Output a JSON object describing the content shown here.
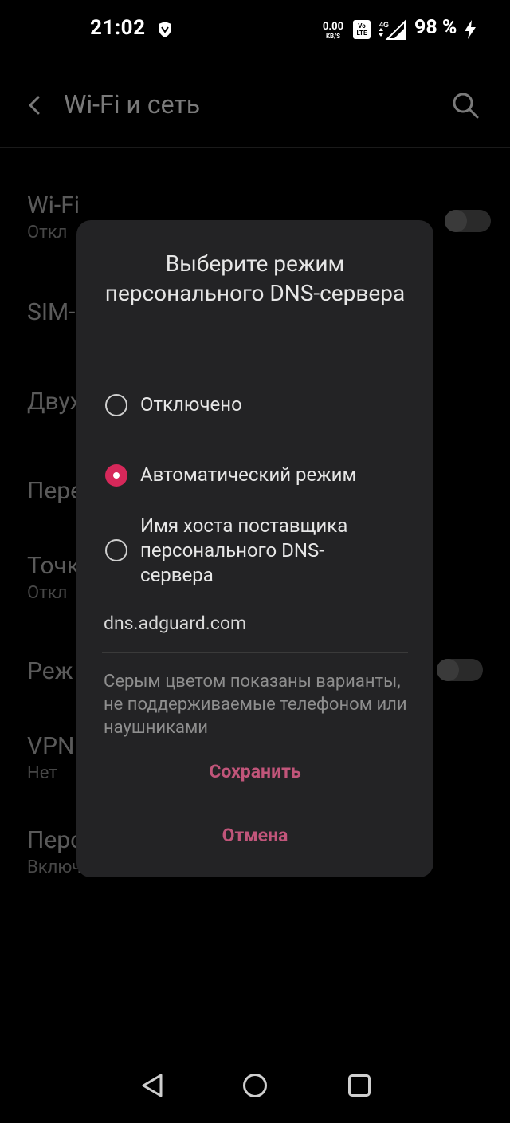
{
  "status_bar": {
    "time": "21:02",
    "net_speed_value": "0.00",
    "net_speed_unit": "KB/S",
    "volte_top": "Vo",
    "volte_bottom": "LTE",
    "network_type": "4G",
    "battery": "98 %",
    "icons": [
      "shield-icon",
      "volte-icon",
      "signal-4g-icon",
      "charging-bolt-icon"
    ]
  },
  "app_bar": {
    "title": "Wi-Fi и сеть",
    "icons": [
      "back-arrow-icon",
      "search-icon"
    ]
  },
  "background_list": {
    "items": [
      {
        "title": "Wi-Fi",
        "subtitle": "Откл"
      },
      {
        "title": "SIM-"
      },
      {
        "title": "Двух"
      },
      {
        "title": "Пере"
      },
      {
        "title": "Точк",
        "subtitle": "Откл"
      },
      {
        "title": "Реж"
      },
      {
        "title": "VPN",
        "subtitle": "Нет"
      },
      {
        "title": "Перс",
        "subtitle": "Включено"
      }
    ]
  },
  "dialog": {
    "title": "Выберите режим персонального DNS-сервера",
    "options": [
      {
        "label": "Отключено",
        "checked": false
      },
      {
        "label": "Автоматический режим",
        "checked": true
      },
      {
        "label": "Имя хоста поставщика персонального DNS-сервера",
        "checked": false
      }
    ],
    "hostname_value": "dns.adguard.com",
    "note": "Серым цветом показаны варианты, не поддерживаемые телефоном или наушниками",
    "save_label": "Сохранить",
    "cancel_label": "Отмена"
  },
  "colors": {
    "accent": "#d6285a",
    "button_text": "#c1557a",
    "dialog_bg": "#232325",
    "screen_bg": "#000000"
  },
  "nav_bar": {
    "icons": [
      "nav-back-icon",
      "nav-home-icon",
      "nav-recents-icon"
    ]
  }
}
